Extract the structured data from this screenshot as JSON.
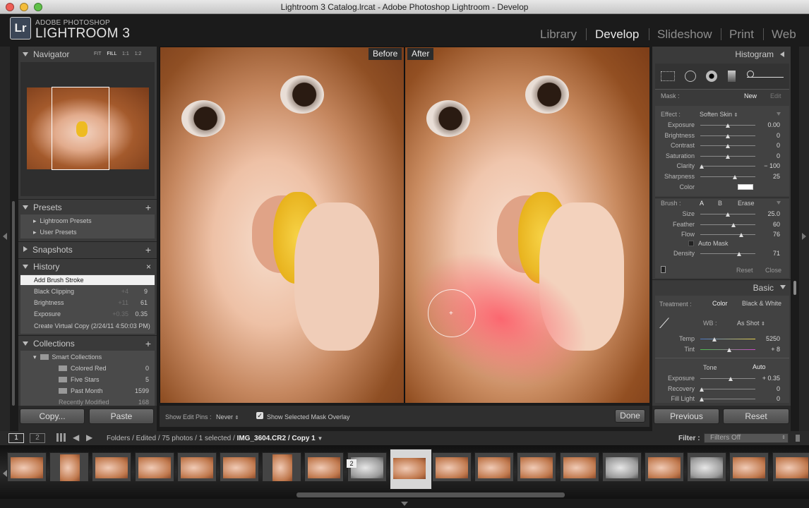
{
  "window": {
    "title": "Lightroom 3 Catalog.lrcat - Adobe Photoshop Lightroom - Develop"
  },
  "identity": {
    "line1": "ADOBE PHOTOSHOP",
    "line2": "LIGHTROOM 3",
    "logo": "Lr"
  },
  "modules": [
    {
      "label": "Library"
    },
    {
      "label": "Develop"
    },
    {
      "label": "Slideshow"
    },
    {
      "label": "Print"
    },
    {
      "label": "Web"
    }
  ],
  "navigator": {
    "title": "Navigator",
    "zoom": [
      "FIT",
      "FILL",
      "1:1",
      "1:2"
    ]
  },
  "presets": {
    "title": "Presets",
    "items": [
      "Lightroom Presets",
      "User Presets"
    ]
  },
  "snapshots": {
    "title": "Snapshots"
  },
  "history": {
    "title": "History",
    "items": [
      {
        "label": "Add Brush Stroke",
        "delta": "",
        "value": ""
      },
      {
        "label": "Black Clipping",
        "delta": "+4",
        "value": "9"
      },
      {
        "label": "Brightness",
        "delta": "+11",
        "value": "61"
      },
      {
        "label": "Exposure",
        "delta": "+0.35",
        "value": "0.35"
      },
      {
        "label": "Create Virtual Copy (2/24/11 4:50:03 PM)",
        "delta": "",
        "value": ""
      }
    ]
  },
  "collections": {
    "title": "Collections",
    "group": "Smart Collections",
    "items": [
      {
        "label": "Colored Red",
        "count": "0"
      },
      {
        "label": "Five Stars",
        "count": "5"
      },
      {
        "label": "Past Month",
        "count": "1599"
      },
      {
        "label": "Recently Modified",
        "count": "168"
      }
    ]
  },
  "left_buttons": {
    "copy": "Copy...",
    "paste": "Paste"
  },
  "viewer": {
    "before": "Before",
    "after": "After"
  },
  "toolbar": {
    "pins_label": "Show Edit Pins :",
    "pins_value": "Never",
    "overlay_label": "Show Selected Mask Overlay",
    "done": "Done"
  },
  "histogram": {
    "title": "Histogram"
  },
  "mask": {
    "label": "Mask :",
    "new": "New",
    "edit": "Edit"
  },
  "effect": {
    "label": "Effect :",
    "value": "Soften Skin",
    "sliders": [
      {
        "label": "Exposure",
        "value": "0.00",
        "pos": 0.5
      },
      {
        "label": "Brightness",
        "value": "0",
        "pos": 0.5
      },
      {
        "label": "Contrast",
        "value": "0",
        "pos": 0.5
      },
      {
        "label": "Saturation",
        "value": "0",
        "pos": 0.5
      },
      {
        "label": "Clarity",
        "value": "− 100",
        "pos": 0.02
      },
      {
        "label": "Sharpness",
        "value": "25",
        "pos": 0.63
      }
    ],
    "color_label": "Color"
  },
  "brush": {
    "label": "Brush :",
    "a": "A",
    "b": "B",
    "erase": "Erase",
    "sliders": [
      {
        "label": "Size",
        "value": "25.0",
        "pos": 0.5
      },
      {
        "label": "Feather",
        "value": "60",
        "pos": 0.6
      },
      {
        "label": "Flow",
        "value": "76",
        "pos": 0.74
      }
    ],
    "auto_mask": "Auto Mask",
    "density": {
      "label": "Density",
      "value": "71",
      "pos": 0.7
    },
    "reset": "Reset",
    "close": "Close"
  },
  "basic": {
    "title": "Basic",
    "treatment_label": "Treatment :",
    "color": "Color",
    "bw": "Black & White",
    "wb_label": "WB :",
    "wb_value": "As Shot",
    "temp": {
      "label": "Temp",
      "value": "5250",
      "pos": 0.25
    },
    "tint": {
      "label": "Tint",
      "value": "+ 8",
      "pos": 0.52
    },
    "tone": "Tone",
    "auto": "Auto",
    "tone_sliders": [
      {
        "label": "Exposure",
        "value": "+ 0.35",
        "pos": 0.55
      },
      {
        "label": "Recovery",
        "value": "0",
        "pos": 0.02
      },
      {
        "label": "Fill Light",
        "value": "0",
        "pos": 0.02
      }
    ]
  },
  "right_buttons": {
    "previous": "Previous",
    "reset": "Reset"
  },
  "filmbar": {
    "view1": "1",
    "view2": "2",
    "path": "Folders / Edited / 75 photos / 1 selected / ",
    "file": "IMG_3604.CR2 / Copy 1",
    "filter_label": "Filter :",
    "filter_value": "Filters Off"
  },
  "filmstrip": {
    "badge": "2"
  }
}
